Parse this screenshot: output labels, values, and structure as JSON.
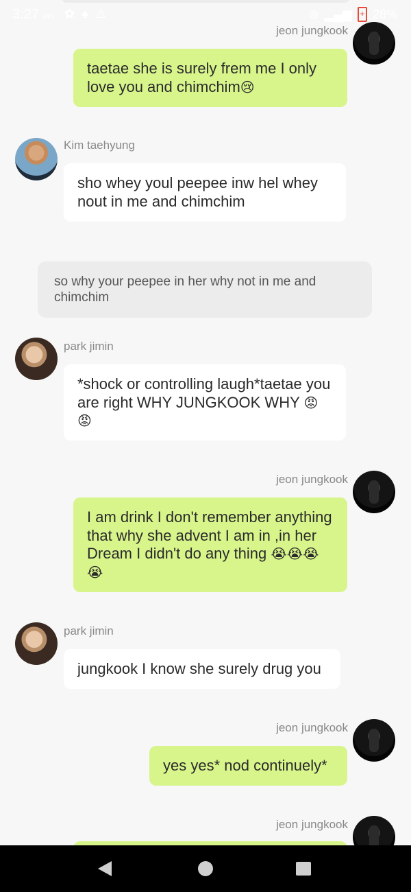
{
  "status_bar": {
    "time": "3:27",
    "ampm": "am",
    "left_icons": [
      "settings-icon",
      "notification-icon",
      "warning-icon"
    ],
    "right_icons": [
      "hotspot-icon",
      "signal-icon",
      "battery-icon"
    ],
    "battery": "28%"
  },
  "messages": [
    {
      "kind": "out",
      "sender": "jeon jungkook",
      "avatar": "jungkook-avatar",
      "text": "taetae she is surely frem me I only love you and chimchim",
      "emoji": "😢"
    },
    {
      "kind": "in",
      "sender": "Kim taehyung",
      "avatar": "taehyung-avatar",
      "text": "sho whey youl peepee inw hel whey nout in me and chimchim",
      "emoji": ""
    },
    {
      "kind": "narration",
      "sender": "",
      "avatar": "",
      "text": "so why your peepee in her why not in me and chimchim",
      "emoji": ""
    },
    {
      "kind": "in",
      "sender": "park jimin",
      "avatar": "jimin-avatar",
      "text": "*shock or controlling laugh*taetae you are right WHY JUNGKOOK WHY",
      "emoji": "😡😡"
    },
    {
      "kind": "out",
      "sender": "jeon jungkook",
      "avatar": "jungkook-avatar",
      "text": "I am drink I don't remember anything that why she advent I am in ,in her Dream I  didn't do any thing",
      "emoji": "😭😭😭😭"
    },
    {
      "kind": "in",
      "sender": "park jimin",
      "avatar": "jimin-avatar",
      "text": "jungkook I know she surely drug you",
      "emoji": ""
    },
    {
      "kind": "out",
      "sender": "jeon jungkook",
      "avatar": "jungkook-avatar",
      "text": "yes yes* nod continuely*",
      "emoji": ""
    },
    {
      "kind": "out",
      "sender": "jeon jungkook",
      "avatar": "jungkook-avatar",
      "text": "",
      "emoji": ""
    }
  ],
  "nav": {
    "icons": [
      "back-icon",
      "home-icon",
      "recents-icon"
    ]
  },
  "colors": {
    "outgoing_bubble": "#d8f58c",
    "incoming_bubble": "#ffffff",
    "narration_bubble": "#ececec",
    "background": "#f7f7f7",
    "nav_bar": "#000000"
  }
}
